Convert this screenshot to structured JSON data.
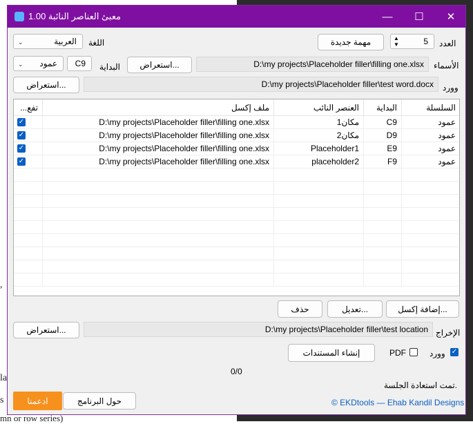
{
  "window": {
    "title": "معبئ العناصر النائبة 1.00"
  },
  "background": {
    "lines": [
      "la",
      "s",
      "mn or row series)"
    ],
    "dot": ", "
  },
  "top": {
    "count_label": "العدد",
    "count_value": "5",
    "new_task": "مهمة جديدة",
    "language_label": "اللغة",
    "language_value": "العربية",
    "names_label": "الأسماء",
    "names_path": "D:\\my projects\\Placeholder filler\\filling one.xlsx",
    "browse": "استعراض...",
    "start_label": "البداية",
    "start_value": "C9",
    "series_value": "عمود",
    "word_label": "وورد",
    "word_path": "D:\\my projects\\Placeholder filler\\test word.docx"
  },
  "table": {
    "headers": {
      "series": "السلسلة",
      "start": "البداية",
      "placeholder": "العنصر النائب",
      "excel": "ملف إكسل",
      "enabled": "...تفع"
    },
    "rows": [
      {
        "series": "عمود",
        "start": "C9",
        "placeholder": "مكان1",
        "excel": "D:\\my projects\\Placeholder filler\\filling one.xlsx"
      },
      {
        "series": "عمود",
        "start": "D9",
        "placeholder": "مكان2",
        "excel": "D:\\my projects\\Placeholder filler\\filling one.xlsx"
      },
      {
        "series": "عمود",
        "start": "E9",
        "placeholder": "Placeholder1",
        "excel": "D:\\my projects\\Placeholder filler\\filling one.xlsx"
      },
      {
        "series": "عمود",
        "start": "F9",
        "placeholder": "placeholder2",
        "excel": "D:\\my projects\\Placeholder filler\\filling one.xlsx"
      }
    ]
  },
  "actions": {
    "add_excel": "إضافة إكسل...",
    "edit": "تعديل...",
    "delete": "حذف"
  },
  "output": {
    "label": "الإخراج",
    "path": "D:\\my projects\\Placeholder filler\\test location",
    "browse": "استعراض...",
    "word": "وورد",
    "pdf": "PDF",
    "create": "إنشاء المستندات",
    "progress": "0/0"
  },
  "footer": {
    "status": "تمت استعادة الجلسة.",
    "credit": "© EKDtools — Ehab Kandil Designs",
    "about": "حول البرنامج",
    "support": "ادعمنا"
  },
  "colors": {
    "titlebar": "#7f0fa0",
    "accent": "#0a5fc4",
    "support": "#f7911e"
  }
}
